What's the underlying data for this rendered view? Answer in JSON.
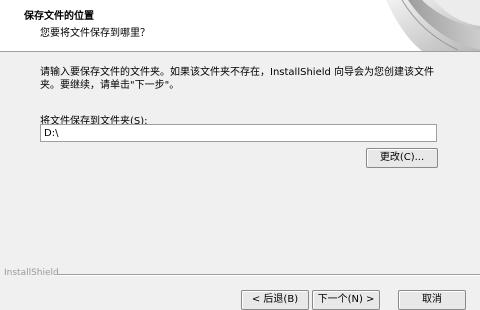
{
  "header": {
    "title": "保存文件的位置",
    "subtitle": "您要将文件保存到哪里？"
  },
  "main": {
    "description": "请输入要保存文件的文件夹。如果该文件夹不存在，InstallShield 向导会为您创建该文件夹。要继续，请单击\"下一步\"。",
    "folder_label": "将文件保存到文件夹(S):",
    "folder_value": "D:\\",
    "browse_label": "更改(C)..."
  },
  "footer": {
    "brand": "InstallShield",
    "back_label": "< 后退(B)",
    "next_label": "下一个(N) >",
    "cancel_label": "取消"
  },
  "colors": {
    "header_bg": "#ffffff",
    "dialog_bg": "#f0f0f0",
    "border": "#a0a0a0"
  },
  "icons": {
    "header_graphic": "page-curl-graphic"
  }
}
